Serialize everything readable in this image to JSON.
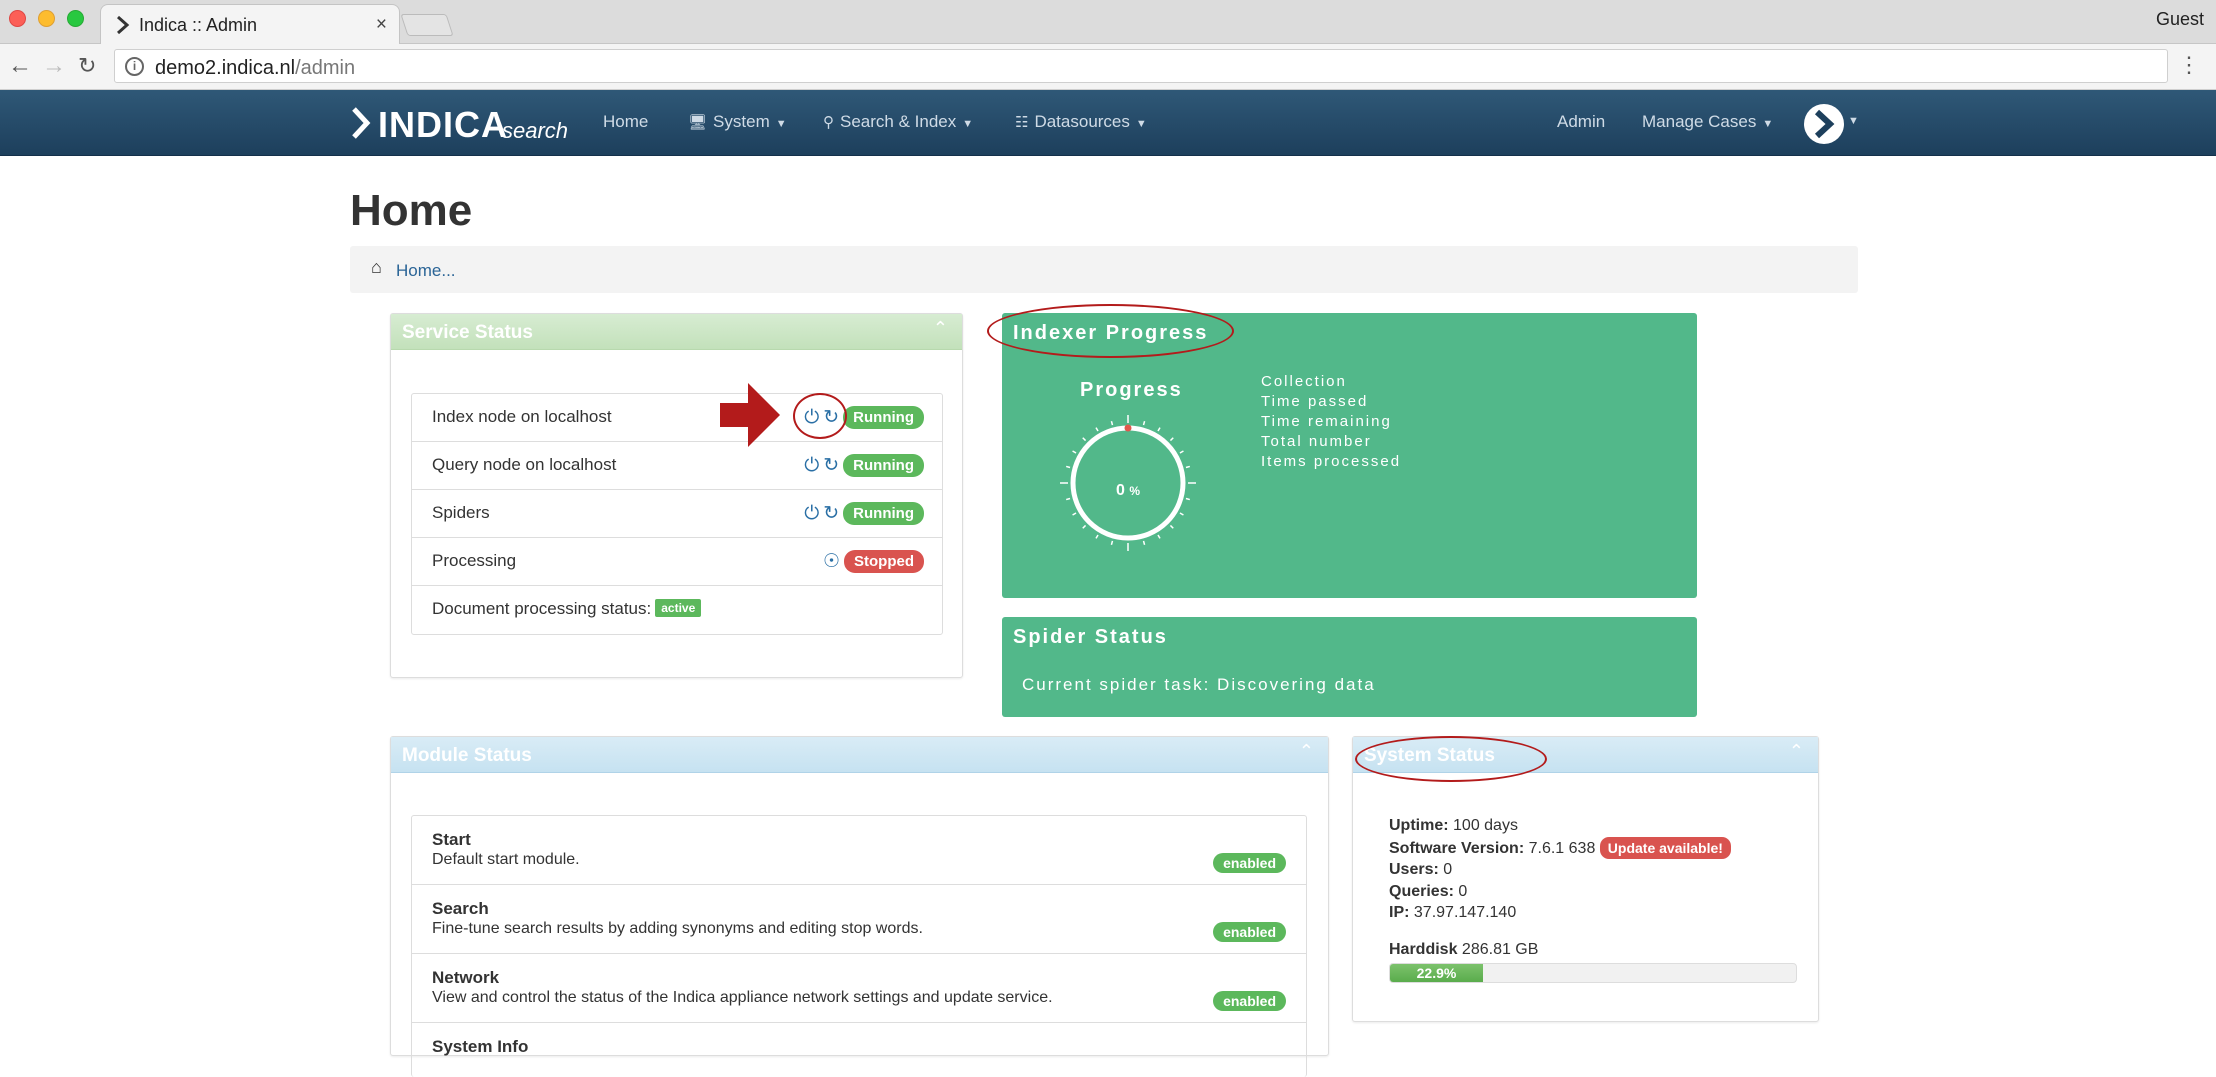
{
  "browser": {
    "tab_title": "Indica :: Admin",
    "tab_close": "×",
    "profile": "Guest",
    "url_host": "demo2.indica.nl",
    "url_path": "/admin",
    "menu": "⋮"
  },
  "navbar": {
    "brand_word": "INDICA",
    "brand_sub": "search",
    "items": [
      {
        "label": "Home",
        "icon": ""
      },
      {
        "label": "System",
        "icon": "monitor-icon",
        "caret": true
      },
      {
        "label": "Search & Index",
        "icon": "search-icon",
        "caret": true
      },
      {
        "label": "Datasources",
        "icon": "sitemap-icon",
        "caret": true
      }
    ],
    "right": [
      {
        "label": "Admin"
      },
      {
        "label": "Manage Cases",
        "caret": true
      }
    ]
  },
  "page": {
    "title": "Home",
    "breadcrumb": "Home..."
  },
  "service_status": {
    "title": "Service Status",
    "rows": [
      {
        "label": "Index node on localhost",
        "status": "Running"
      },
      {
        "label": "Query node on localhost",
        "status": "Running"
      },
      {
        "label": "Spiders",
        "status": "Running"
      },
      {
        "label": "Processing",
        "status": "Stopped"
      },
      {
        "label": "Document processing status:",
        "tag": "active"
      }
    ]
  },
  "indexer_progress": {
    "title": "Indexer Progress",
    "progress_label": "Progress",
    "percent": "0",
    "percent_unit": "%",
    "fields": [
      "Collection",
      "Time passed",
      "Time remaining",
      "Total number",
      "Items processed"
    ]
  },
  "spider_status": {
    "title": "Spider Status",
    "task": "Current spider task: Discovering data"
  },
  "module_status": {
    "title": "Module Status",
    "modules": [
      {
        "name": "Start",
        "desc": "Default start module.",
        "status": "enabled"
      },
      {
        "name": "Search",
        "desc": "Fine-tune search results by adding synonyms and editing stop words.",
        "status": "enabled"
      },
      {
        "name": "Network",
        "desc": "View and control the status of the Indica appliance network settings and update service.",
        "status": "enabled"
      },
      {
        "name": "System Info",
        "desc": "",
        "status": ""
      }
    ]
  },
  "system_status": {
    "title": "System Status",
    "uptime_label": "Uptime:",
    "uptime": "100 days",
    "version_label": "Software Version:",
    "version": "7.6.1 638",
    "update_badge": "Update available!",
    "users_label": "Users:",
    "users": "0",
    "queries_label": "Queries:",
    "queries": "0",
    "ip_label": "IP:",
    "ip": "37.97.147.140",
    "harddisk_label": "Harddisk",
    "harddisk_size": "286.81 GB",
    "harddisk_used_pct": 22.9,
    "harddisk_used_text": "22.9%"
  },
  "colors": {
    "navbar": "#1d3f5c",
    "teal": "#52b88a",
    "running": "#5cb85c",
    "stopped": "#d9534f",
    "annotation": "#b31b1b"
  }
}
